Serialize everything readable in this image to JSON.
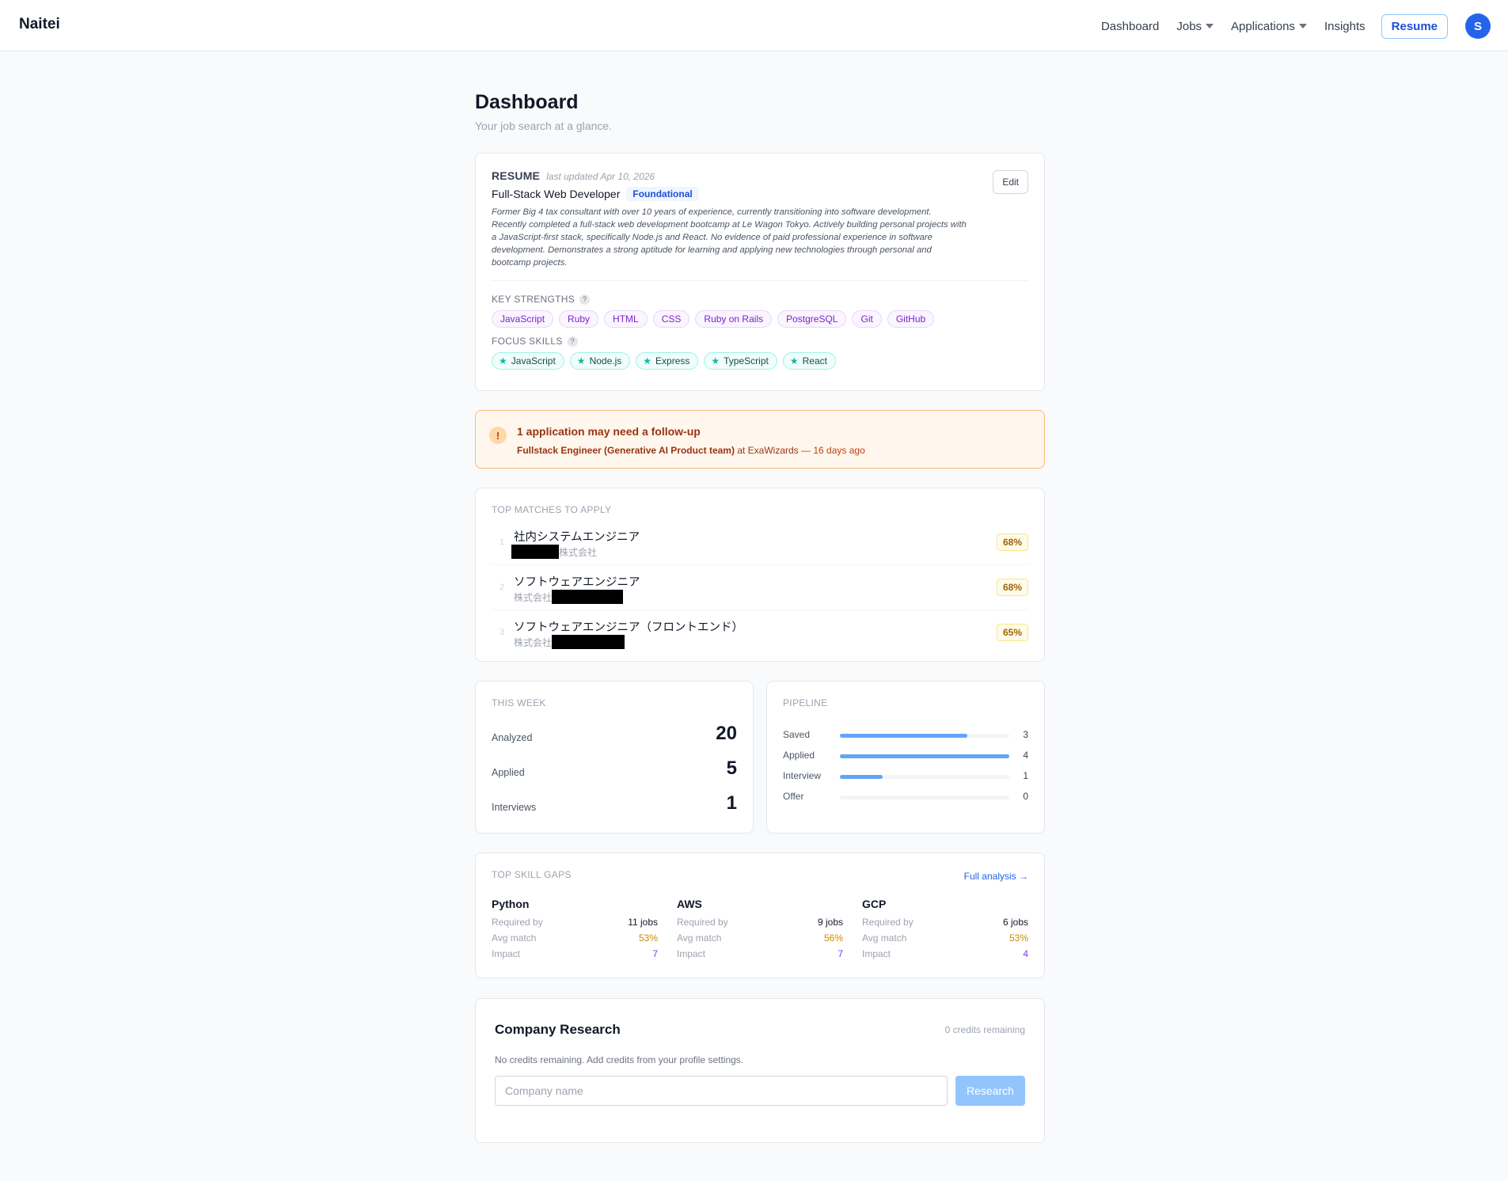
{
  "app": {
    "brand": "Naitei"
  },
  "nav": {
    "dashboard": "Dashboard",
    "jobs": "Jobs",
    "applications": "Applications",
    "insights": "Insights",
    "resume": "Resume",
    "avatar_initial": "S"
  },
  "page": {
    "title": "Dashboard",
    "subtitle": "Your job search at a glance."
  },
  "resume": {
    "label": "RESUME",
    "updated": "last updated Apr 10, 2026",
    "role": "Full-Stack Web Developer",
    "level": "Foundational",
    "edit_label": "Edit",
    "summary": "Former Big 4 tax consultant with over 10 years of experience, currently transitioning into software development. Recently completed a full-stack web development bootcamp at Le Wagon Tokyo. Actively building personal projects with a JavaScript-first stack, specifically Node.js and React. No evidence of paid professional experience in software development. Demonstrates a strong aptitude for learning and applying new technologies through personal and bootcamp projects.",
    "key_strengths_label": "KEY STRENGTHS",
    "key_strengths": [
      "JavaScript",
      "Ruby",
      "HTML",
      "CSS",
      "Ruby on Rails",
      "PostgreSQL",
      "Git",
      "GitHub"
    ],
    "focus_skills_label": "FOCUS SKILLS",
    "focus_skills": [
      "JavaScript",
      "Node.js",
      "Express",
      "TypeScript",
      "React"
    ]
  },
  "follow_up": {
    "icon": "!",
    "title": "1 application may need a follow-up",
    "job": "Fullstack Engineer (Generative AI Product team)",
    "at": "at",
    "company": "ExaWizards",
    "ago": "— 16 days ago"
  },
  "top_matches": {
    "label": "TOP MATCHES TO APPLY",
    "items": [
      {
        "rank": "1",
        "title": "社内システムエンジニア",
        "company_suffix": "株式会社",
        "score": "68%"
      },
      {
        "rank": "2",
        "title": "ソフトウェアエンジニア",
        "company_prefix": "株式会社",
        "score": "68%"
      },
      {
        "rank": "3",
        "title": "ソフトウェアエンジニア（フロントエンド）",
        "company_prefix": "株式会社",
        "score": "65%"
      }
    ]
  },
  "this_week": {
    "label": "THIS WEEK",
    "analyzed_label": "Analyzed",
    "analyzed": "20",
    "applied_label": "Applied",
    "applied": "5",
    "interviews_label": "Interviews",
    "interviews": "1"
  },
  "pipeline": {
    "label": "PIPELINE",
    "max": 4,
    "stages": [
      {
        "label": "Saved",
        "count": "3",
        "value": 3
      },
      {
        "label": "Applied",
        "count": "4",
        "value": 4
      },
      {
        "label": "Interview",
        "count": "1",
        "value": 1
      },
      {
        "label": "Offer",
        "count": "0",
        "value": 0
      }
    ]
  },
  "skill_gaps": {
    "label": "TOP SKILL GAPS",
    "full_analysis": "Full analysis →",
    "required_label": "Required by",
    "match_label": "Avg match",
    "impact_label": "Impact",
    "items": [
      {
        "skill": "Python",
        "jobs": "11 jobs",
        "match": "53%",
        "impact": "7"
      },
      {
        "skill": "AWS",
        "jobs": "9 jobs",
        "match": "56%",
        "impact": "7"
      },
      {
        "skill": "GCP",
        "jobs": "6 jobs",
        "match": "53%",
        "impact": "4"
      }
    ]
  },
  "research": {
    "title": "Company Research",
    "credits": "0 credits remaining",
    "notice": "No credits remaining. Add credits from your profile settings.",
    "placeholder": "Company name",
    "button": "Research"
  },
  "colors": {
    "accent": "#2563eb",
    "pipeline_bar": "#60a5fa",
    "alert_bg": "#fff7ed"
  }
}
